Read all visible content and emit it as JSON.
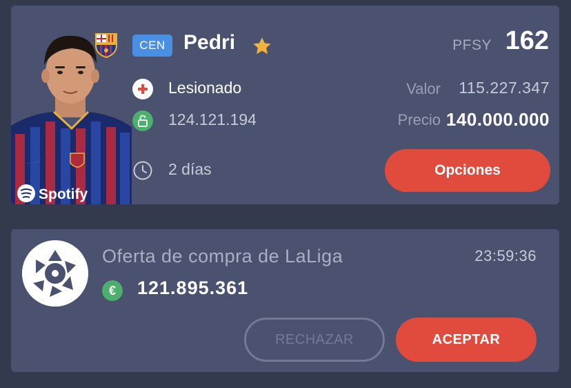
{
  "player": {
    "club": "FC Barcelona",
    "position": "CEN",
    "name": "Pedri",
    "favorite": true,
    "points_label": "PFSY",
    "points": "162",
    "status": "Lesionado",
    "clause": "124.121.194",
    "days": "2 días",
    "valor_label": "Valor",
    "valor": "115.227.347",
    "precio_label": "Precio",
    "precio": "140.000.000",
    "options_label": "Opciones",
    "shirt_sponsor": "Spotify"
  },
  "offer": {
    "title": "Oferta de compra de LaLiga",
    "timer": "23:59:36",
    "currency_symbol": "€",
    "amount": "121.895.361",
    "reject_label": "RECHAZAR",
    "accept_label": "ACEPTAR"
  },
  "icons": {
    "injury": "red-cross-icon",
    "clause": "unlock-icon",
    "days": "clock-icon",
    "favorite": "star-icon",
    "currency": "euro-icon"
  },
  "colors": {
    "background": "#333a4e",
    "card": "#4a5270",
    "accent_red": "#e04b3d",
    "position_blue": "#4a90e2",
    "green": "#4caf6e",
    "star": "#f2b33d"
  }
}
